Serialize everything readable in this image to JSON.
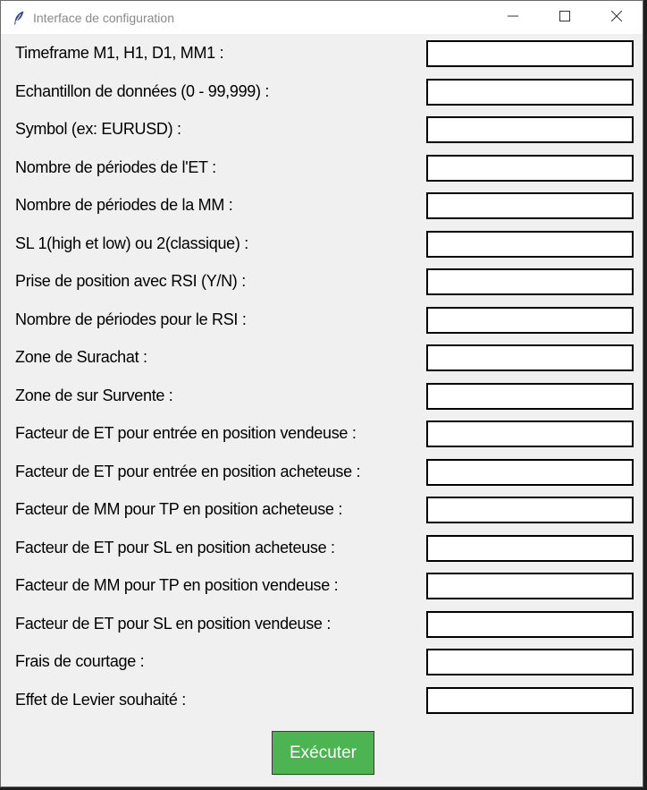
{
  "window": {
    "title": "Interface de configuration"
  },
  "icons": {
    "app": "feather-icon",
    "minimize": "minimize-icon",
    "maximize": "maximize-icon",
    "close": "close-icon"
  },
  "colors": {
    "window_bg": "#f0f0f0",
    "button_bg": "#4cb552",
    "button_text": "#ffffff"
  },
  "fields": [
    {
      "label": "Timeframe M1, H1, D1, MM1 :",
      "value": ""
    },
    {
      "label": "Echantillon de données (0 - 99,999) :",
      "value": ""
    },
    {
      "label": "Symbol (ex: EURUSD) :",
      "value": ""
    },
    {
      "label": "Nombre de périodes de l'ET :",
      "value": ""
    },
    {
      "label": "Nombre de périodes de la MM :",
      "value": ""
    },
    {
      "label": "SL 1(high et low) ou 2(classique) :",
      "value": ""
    },
    {
      "label": "Prise de position avec RSI (Y/N) :",
      "value": ""
    },
    {
      "label": "Nombre de périodes pour le RSI :",
      "value": ""
    },
    {
      "label": "Zone de Surachat :",
      "value": ""
    },
    {
      "label": "Zone de sur Survente :",
      "value": ""
    },
    {
      "label": "Facteur de ET pour entrée en position vendeuse :",
      "value": ""
    },
    {
      "label": "Facteur de ET pour entrée en position acheteuse :",
      "value": ""
    },
    {
      "label": "Facteur de MM pour TP en position acheteuse :",
      "value": ""
    },
    {
      "label": "Facteur de ET pour SL en position acheteuse :",
      "value": ""
    },
    {
      "label": "Facteur de MM pour TP en position vendeuse :",
      "value": ""
    },
    {
      "label": "Facteur de ET pour SL en position vendeuse :",
      "value": ""
    },
    {
      "label": "Frais de courtage :",
      "value": ""
    },
    {
      "label": "Effet de Levier souhaité :",
      "value": ""
    }
  ],
  "actions": {
    "run_label": "Exécuter"
  }
}
